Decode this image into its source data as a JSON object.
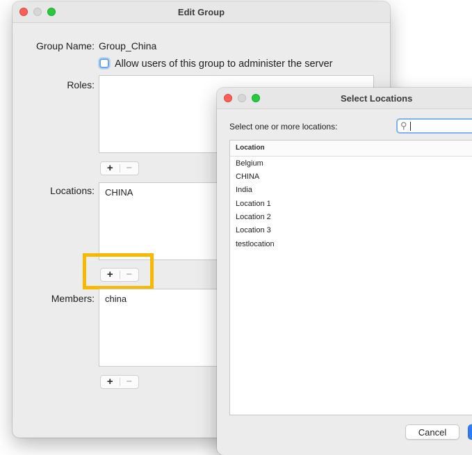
{
  "edit_group": {
    "title": "Edit Group",
    "group_name_label": "Group Name:",
    "group_name_value": "Group_China",
    "admin_checkbox_label": "Allow users of this group to administer the server",
    "roles_label": "Roles:",
    "locations_label": "Locations:",
    "locations_items": [
      "CHINA"
    ],
    "members_label": "Members:",
    "members_items": [
      "china"
    ],
    "add_symbol": "+",
    "remove_symbol": "−"
  },
  "select_locations": {
    "title": "Select Locations",
    "prompt": "Select one or more locations:",
    "search_icon": "magnifier-icon",
    "column_header": "Location",
    "items": [
      "Belgium",
      "CHINA",
      "India",
      "Location 1",
      "Location 2",
      "Location 3",
      "testlocation"
    ],
    "cancel_label": "Cancel"
  },
  "colors": {
    "highlight": "#f7b800",
    "accent": "#2f7cf6"
  }
}
